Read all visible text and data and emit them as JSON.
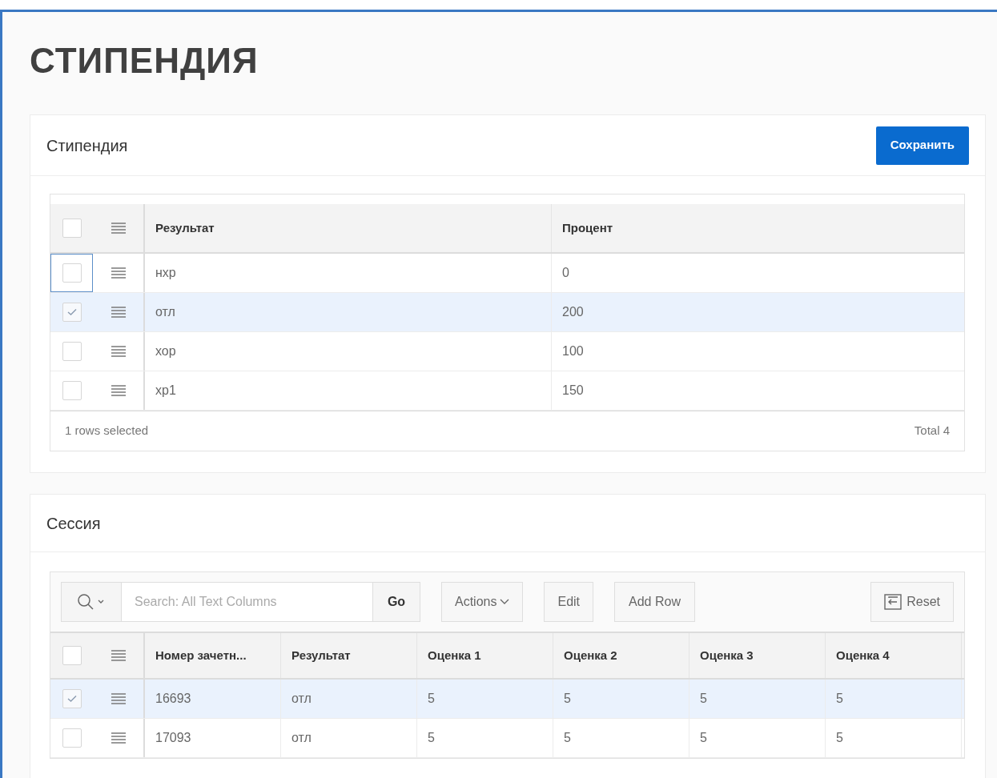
{
  "page_title": "СТИПЕНДИЯ",
  "scholarship": {
    "title": "Стипендия",
    "save_button": "Сохранить",
    "all_selected": false,
    "columns": [
      "Результат",
      "Процент"
    ],
    "rows": [
      {
        "selected": false,
        "focused": true,
        "cells": [
          "нхр",
          "0"
        ]
      },
      {
        "selected": true,
        "focused": false,
        "cells": [
          "отл",
          "200"
        ]
      },
      {
        "selected": false,
        "focused": false,
        "cells": [
          "хор",
          "100"
        ]
      },
      {
        "selected": false,
        "focused": false,
        "cells": [
          "хр1",
          "150"
        ]
      }
    ],
    "footer_left": "1 rows selected",
    "footer_right": "Total 4"
  },
  "session": {
    "title": "Сессия",
    "search": {
      "placeholder": "Search: All Text Columns"
    },
    "go_button": "Go",
    "actions_button": "Actions",
    "edit_button": "Edit",
    "add_row_button": "Add Row",
    "reset_button": "Reset",
    "all_selected": false,
    "columns": [
      "Номер зачетн...",
      "Результат",
      "Оценка 1",
      "Оценка 2",
      "Оценка 3",
      "Оценка 4"
    ],
    "rows": [
      {
        "selected": true,
        "cells": [
          "16693",
          "отл",
          "5",
          "5",
          "5",
          "5"
        ]
      },
      {
        "selected": false,
        "cells": [
          "17093",
          "отл",
          "5",
          "5",
          "5",
          "5"
        ]
      }
    ]
  }
}
